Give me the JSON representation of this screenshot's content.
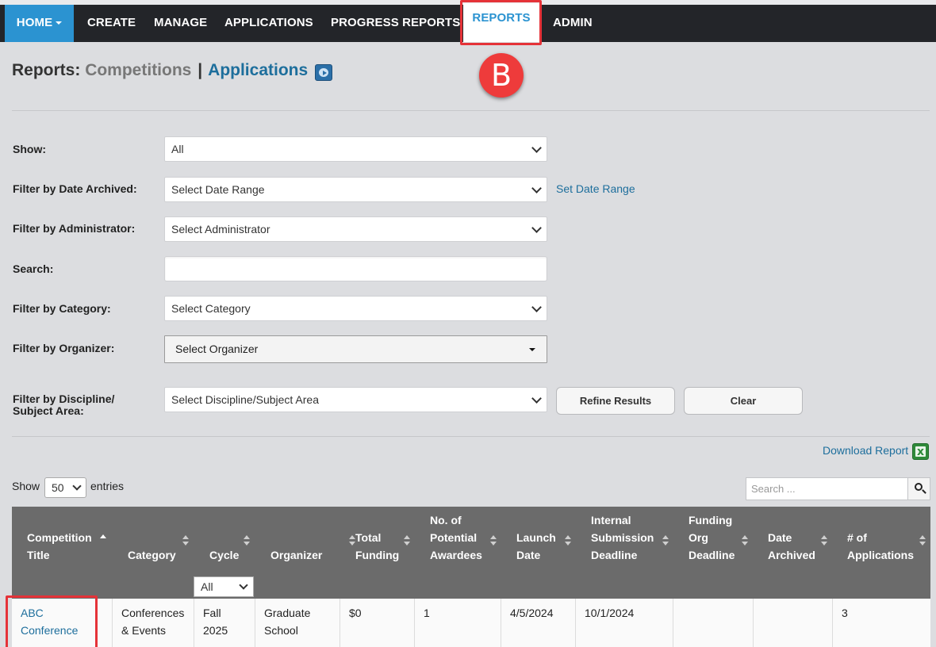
{
  "nav": {
    "home": "HOME",
    "items": [
      "CREATE",
      "MANAGE",
      "APPLICATIONS",
      "PROGRESS REPORTS",
      "REPORTS",
      "ADMIN"
    ],
    "active": "REPORTS"
  },
  "annotation": {
    "marker": "B"
  },
  "page": {
    "title_label": "Reports:",
    "title_competitions": "Competitions",
    "title_separator": "|",
    "title_applications": "Applications"
  },
  "filters": {
    "show_label": "Show:",
    "show_value": "All",
    "date_archived_label": "Filter by Date Archived:",
    "date_archived_value": "Select Date Range",
    "set_date_range": "Set Date Range",
    "administrator_label": "Filter by Administrator:",
    "administrator_value": "Select Administrator",
    "search_label": "Search:",
    "search_value": "",
    "category_label": "Filter by Category:",
    "category_value": "Select Category",
    "organizer_label": "Filter by Organizer:",
    "organizer_value": "Select Organizer",
    "discipline_label_1": "Filter by Discipline/",
    "discipline_label_2": "Subject Area:",
    "discipline_value": "Select Discipline/Subject Area",
    "refine_button": "Refine Results",
    "clear_button": "Clear"
  },
  "report": {
    "download_label": "Download Report",
    "excel_icon": "excel-icon",
    "show_prefix": "Show",
    "page_length": "50",
    "show_suffix": "entries",
    "search_placeholder": "Search ...",
    "cycle_filter": "All"
  },
  "table": {
    "columns": [
      {
        "line1": "",
        "line2": "Competition",
        "line3": "Title",
        "sort": "asc"
      },
      {
        "line1": "",
        "line2": "",
        "line3": "Category",
        "sort": "both"
      },
      {
        "line1": "",
        "line2": "",
        "line3": "Cycle",
        "sort": "both"
      },
      {
        "line1": "",
        "line2": "",
        "line3": "Organizer",
        "sort": "both"
      },
      {
        "line1": "",
        "line2": "Total",
        "line3": "Funding",
        "sort": "both"
      },
      {
        "line1": "No. of",
        "line2": "Potential",
        "line3": "Awardees",
        "sort": "both"
      },
      {
        "line1": "",
        "line2": "Launch",
        "line3": "Date",
        "sort": "both"
      },
      {
        "line1": "Internal",
        "line2": "Submission",
        "line3": "Deadline",
        "sort": "both"
      },
      {
        "line1": "Funding",
        "line2": "Org",
        "line3": "Deadline",
        "sort": "both"
      },
      {
        "line1": "",
        "line2": "Date",
        "line3": "Archived",
        "sort": "both"
      },
      {
        "line1": "",
        "line2": "# of",
        "line3": "Applications",
        "sort": "both"
      }
    ],
    "rows": [
      {
        "title": "ABC\nConference",
        "category": "Conferences\n& Events",
        "cycle": "Fall\n2025",
        "organizer": "Graduate\nSchool",
        "total_funding": "$0",
        "potential_awardees": "1",
        "launch_date": "4/5/2024",
        "internal_deadline": "10/1/2024",
        "funding_org_deadline": "",
        "date_archived": "",
        "num_applications": "3"
      }
    ]
  }
}
